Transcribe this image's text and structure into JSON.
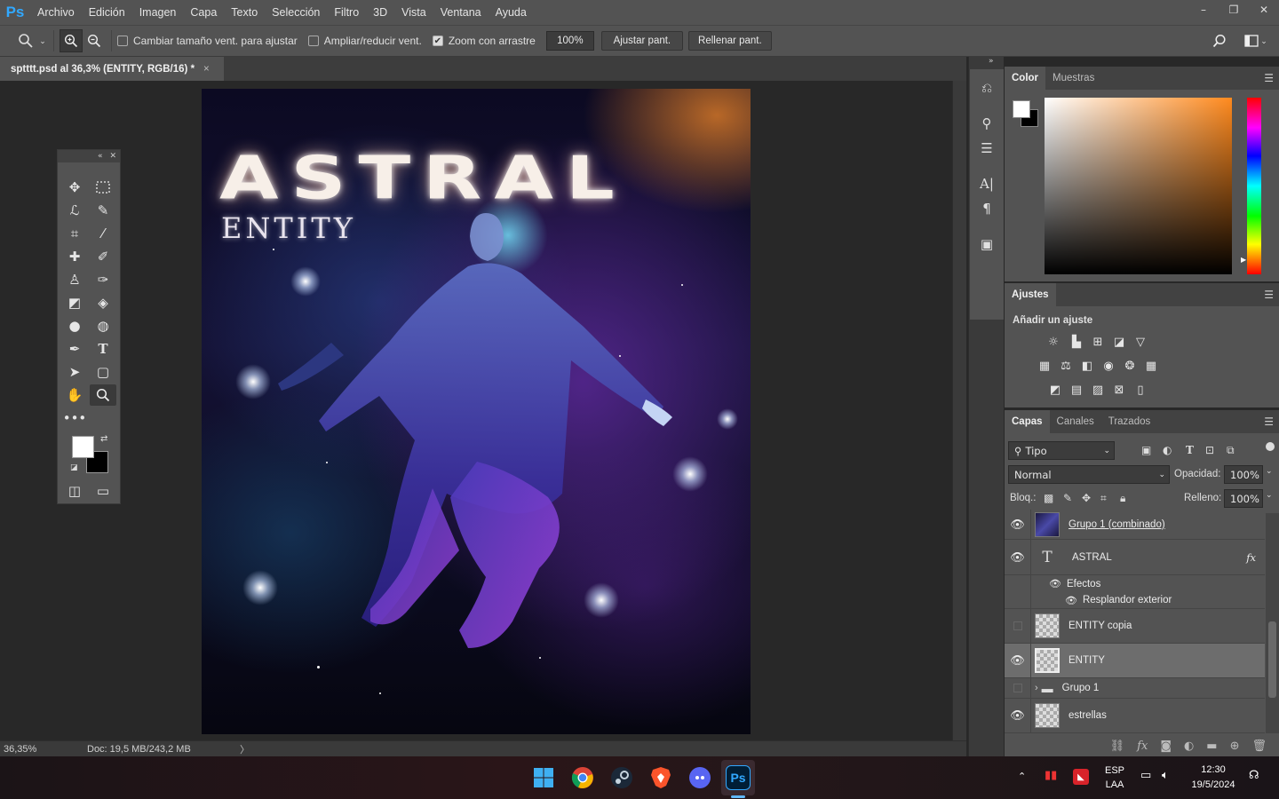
{
  "app": {
    "logo": "Ps",
    "menu": [
      "Archivo",
      "Edición",
      "Imagen",
      "Capa",
      "Texto",
      "Selección",
      "Filtro",
      "3D",
      "Vista",
      "Ventana",
      "Ayuda"
    ],
    "window_controls": [
      "–",
      "❐",
      "✕"
    ]
  },
  "options": {
    "resize_windows_label": "Cambiar tamaño vent. para ajustar",
    "resize_windows_checked": false,
    "zoom_all_label": "Ampliar/reducir vent.",
    "zoom_all_checked": false,
    "scrubby_zoom_label": "Zoom con arrastre",
    "scrubby_zoom_checked": true,
    "zoom_value": "100%",
    "fit_screen_label": "Ajustar pant.",
    "fill_screen_label": "Rellenar pant."
  },
  "document": {
    "tab_title": "sptttt.psd al 36,3% (ENTITY, RGB/16) *",
    "tab_close": "×",
    "artwork_title": "ASTRAL",
    "artwork_subtitle": "ENTITY"
  },
  "status": {
    "zoom": "36,35%",
    "doc_info": "Doc: 19,5 MB/243,2 MB",
    "arrow": "〉"
  },
  "panels": {
    "color_tabs": [
      "Color",
      "Muestras"
    ],
    "adjust_tab": "Ajustes",
    "adjust_title": "Añadir un ajuste",
    "layers_tabs": [
      "Capas",
      "Canales",
      "Trazados"
    ],
    "filter_kind": "Tipo",
    "blend_mode": "Normal",
    "opacity_label": "Opacidad:",
    "opacity_value": "100%",
    "lock_label": "Bloq.:",
    "fill_label": "Relleno:",
    "fill_value": "100%"
  },
  "layers": [
    {
      "name": "Grupo 1 (combinado)",
      "visible": true,
      "kind": "merged"
    },
    {
      "name": "ASTRAL",
      "visible": true,
      "kind": "text",
      "fx": "fx"
    },
    {
      "name": "Efectos",
      "visible": true,
      "kind": "effects"
    },
    {
      "name": "Resplandor exterior",
      "visible": true,
      "kind": "effect"
    },
    {
      "name": "ENTITY copia",
      "visible": false,
      "kind": "pixel"
    },
    {
      "name": "ENTITY",
      "visible": true,
      "kind": "pixel",
      "selected": true
    },
    {
      "name": "Grupo 1",
      "visible": false,
      "kind": "group"
    },
    {
      "name": "estrellas",
      "visible": true,
      "kind": "pixel"
    }
  ],
  "taskbar": {
    "lang_top": "ESP",
    "lang_bottom": "LAA",
    "time": "12:30",
    "date": "19/5/2024",
    "ps_label": "Ps"
  },
  "colors": {
    "accent": "#31a8ff",
    "panel_bg": "#535353",
    "dark_bg": "#282828",
    "color_picker_hue": "#ff8a1e"
  }
}
